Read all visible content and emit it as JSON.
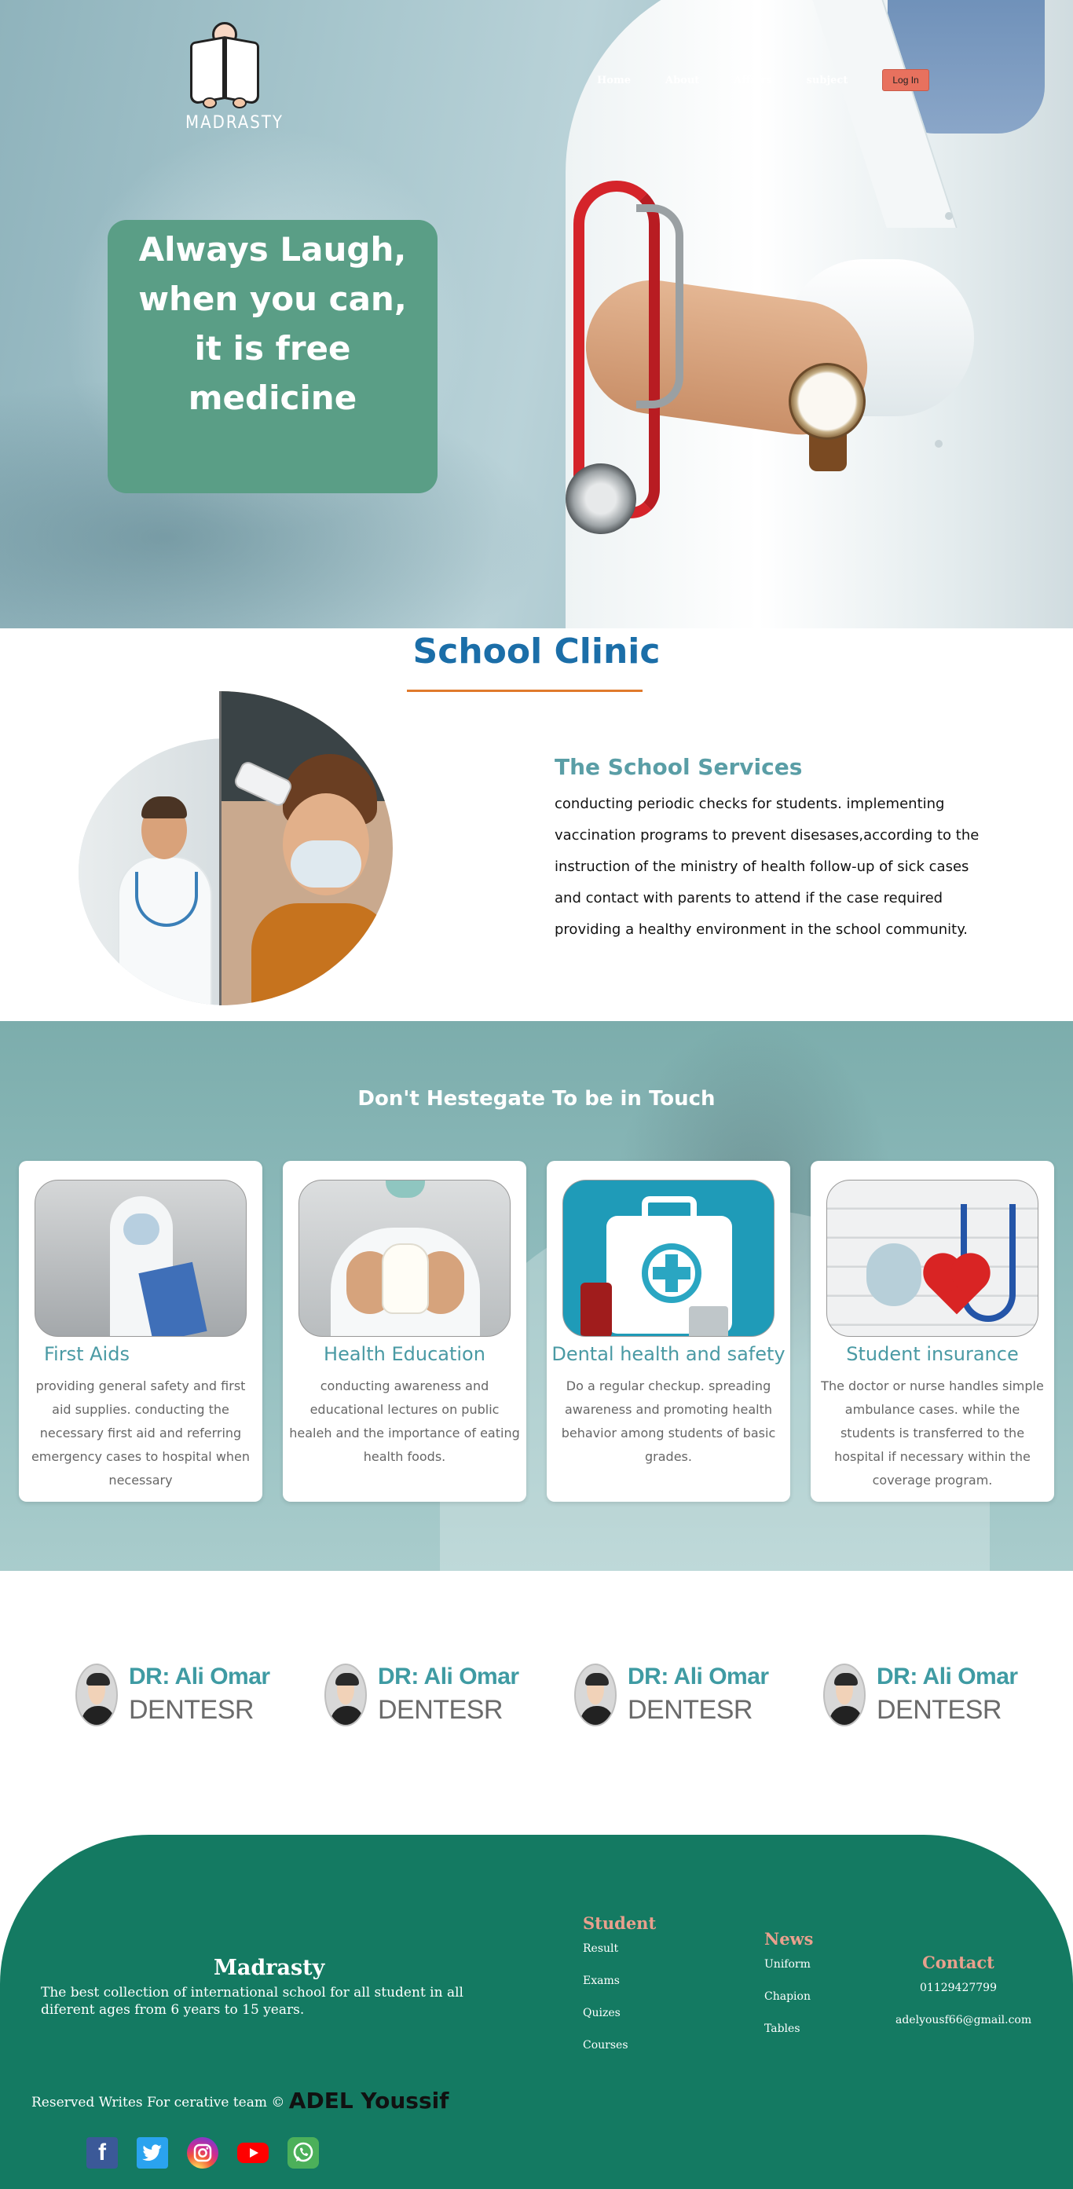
{
  "brand": {
    "logo_text": "MADRASTY"
  },
  "nav": {
    "items": [
      "Home",
      "About",
      "Affairs",
      "subject"
    ],
    "login": "Log In"
  },
  "hero": {
    "quote_lines": [
      "Always Laugh,",
      "when you can,",
      "it is free",
      "medicine"
    ]
  },
  "clinic": {
    "title": "School Clinic",
    "services_title": "The School Services",
    "services_lines": [
      "conducting periodic checks for students. implementing",
      "vaccination programs to prevent disesases,according to the",
      "instruction of the ministry of health follow-up of sick cases",
      "and contact with parents to attend if the case required",
      "providing a healthy environment in the school community."
    ]
  },
  "touch": {
    "title": "Don't Hestegate To be in Touch",
    "cards": [
      {
        "title": "First Aids",
        "desc": "providing general safety and first aid supplies. conducting the necessary first aid and referring emergency cases to hospital when necessary"
      },
      {
        "title": "Health Education",
        "desc": "conducting awareness and educational lectures on public healeh and the importance of eating health foods."
      },
      {
        "title": "Dental health and safety",
        "desc": "Do a regular checkup. spreading awareness and promoting health behavior among students of basic grades."
      },
      {
        "title": "Student insurance",
        "desc": "The doctor or nurse handles simple ambulance cases. while the students is transferred to the hospital if necessary within the coverage program."
      }
    ]
  },
  "doctors": [
    {
      "name": "DR: Ali Omar",
      "spec": "DENTESR"
    },
    {
      "name": "DR: Ali Omar",
      "spec": "DENTESR"
    },
    {
      "name": "DR: Ali Omar",
      "spec": "DENTESR"
    },
    {
      "name": "DR: Ali Omar",
      "spec": "DENTESR"
    }
  ],
  "footer": {
    "brand": "Madrasty",
    "desc": "The best collection of international school for all student in all diferent ages from 6 years to 15 years.",
    "student": {
      "heading": "Student",
      "links": [
        "Result",
        "Exams",
        "Quizes",
        "Courses"
      ]
    },
    "news": {
      "heading": "News",
      "links": [
        "Uniform",
        "Chapion",
        "Tables"
      ]
    },
    "contact": {
      "heading": "Contact",
      "phone": "01129427799",
      "email": "adelyousf66@gmail.com"
    },
    "copyright": "Reserved Writes For cerative team ©",
    "author": "ADEL Youssif",
    "socials": [
      "facebook-icon",
      "twitter-icon",
      "instagram-icon",
      "youtube-icon",
      "whatsapp-icon"
    ]
  },
  "colors": {
    "quote_bg": "#5a9e86",
    "clinic_title": "#1b6ea8",
    "accent_line": "#e07a2c",
    "card_title": "#4a9aa4",
    "footer_bg": "#147a62",
    "footer_heading": "#e9a08d",
    "login_bg": "#e8715e"
  }
}
